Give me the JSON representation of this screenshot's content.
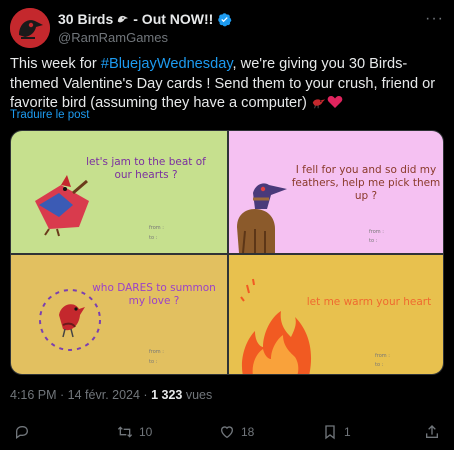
{
  "post": {
    "display_name": "30 Birds",
    "display_name_suffix": "- Out NOW!!",
    "handle": "@RamRamGames",
    "more_label": "···",
    "text": {
      "part1": "This week for ",
      "hashtag": "#BluejayWednesday",
      "part2": ", we're giving you 30 Birds-themed Valentine's Day cards ! Send them to your crush, friend or favorite bird (assuming they have a computer) "
    },
    "translate_label": "Traduire le post",
    "time": "4:16 PM",
    "separator": " · ",
    "date": "14 févr. 2024",
    "views_count": "1 323",
    "views_label": " vues"
  },
  "cards": [
    {
      "text": "let's jam to the beat of our hearts ?",
      "from": "from :",
      "to": "to :",
      "color": "#c6e08e",
      "text_color": "#7b2fa0"
    },
    {
      "text": "I fell for you and so did my feathers, help me pick them up ?",
      "from": "from :",
      "to": "to :",
      "color": "#f5c1f2",
      "text_color": "#8a3a2a"
    },
    {
      "text": "who DARES to summon my love ?",
      "from": "from :",
      "to": "to :",
      "color": "#e2c060",
      "text_color": "#9b42c8"
    },
    {
      "text": "let me warm your heart",
      "from": "from :",
      "to": "to :",
      "color": "#e8c14e",
      "text_color": "#ef6a2f"
    }
  ],
  "actions": {
    "reply_count": "",
    "repost_count": "10",
    "like_count": "18",
    "bookmark_count": "1"
  },
  "colors": {
    "background": "#000000",
    "text": "#e7e9ea",
    "muted": "#71767b",
    "accent": "#1d9bf0"
  },
  "icons": [
    "bird-skull-logo-icon",
    "verified-badge-icon",
    "more-icon",
    "bird-emoji-icon",
    "heart-emoji-icon",
    "reply-icon",
    "repost-icon",
    "like-icon",
    "bookmark-icon",
    "share-icon"
  ]
}
